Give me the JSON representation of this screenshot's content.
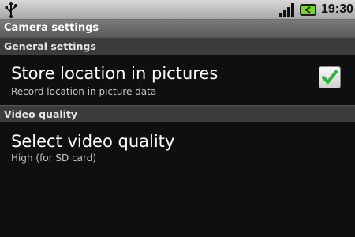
{
  "status_bar": {
    "time": "19:30",
    "icons": [
      "usb-icon",
      "signal-icon",
      "battery-charging-icon"
    ],
    "battery_color": "#79d628"
  },
  "title": "Camera settings",
  "categories": [
    {
      "label": "General settings",
      "items": [
        {
          "title": "Store location in pictures",
          "summary": "Record location in picture data",
          "checked": true
        }
      ]
    },
    {
      "label": "Video quality",
      "items": [
        {
          "title": "Select video quality",
          "summary": "High (for SD card)"
        }
      ]
    }
  ],
  "colors": {
    "checkmark": "#27b534",
    "category_bg": "#3c3c3c",
    "background": "#0f0f0f"
  }
}
